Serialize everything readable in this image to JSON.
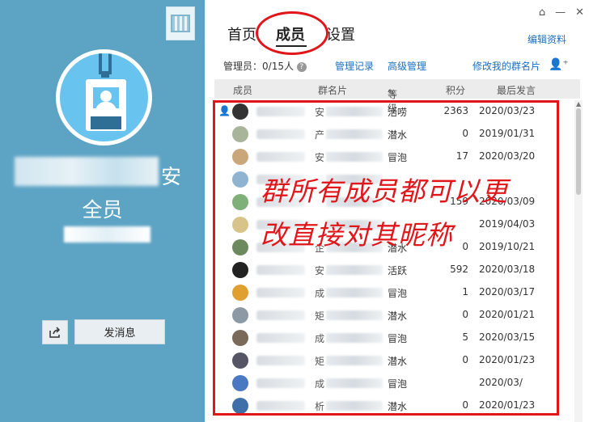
{
  "left": {
    "name_line1": "安",
    "name_line2": "全员",
    "send_message": "发消息"
  },
  "header": {
    "tabs": [
      "首页",
      "成员",
      "设置"
    ],
    "edit_profile": "编辑资料"
  },
  "toolbar": {
    "admin_label": "管理员：",
    "admin_count": "0/15人",
    "manage_log": "管理记录",
    "advanced": "高级管理",
    "edit_card": "修改我的群名片"
  },
  "table": {
    "headers": [
      "成员",
      "群名片",
      "等级",
      "积分",
      "最后发言"
    ],
    "rows": [
      {
        "card": "安",
        "level": "活唠",
        "points": "2363",
        "date": "2020/03/23"
      },
      {
        "card": "产",
        "level": "潜水",
        "points": "0",
        "date": "2019/01/31"
      },
      {
        "card": "安",
        "level": "冒泡",
        "points": "17",
        "date": "2020/03/20"
      },
      {
        "card": "",
        "level": "",
        "points": "",
        "date": ""
      },
      {
        "card": "",
        "level": "",
        "points": "159",
        "date": "2020/03/09"
      },
      {
        "card": "",
        "level": "",
        "points": "",
        "date": "2019/04/03"
      },
      {
        "card": "企",
        "level": "潜水",
        "points": "0",
        "date": "2019/10/21"
      },
      {
        "card": "安",
        "level": "活跃",
        "points": "592",
        "date": "2020/03/18"
      },
      {
        "card": "成",
        "level": "冒泡",
        "points": "1",
        "date": "2020/03/17"
      },
      {
        "card": "矩",
        "level": "潜水",
        "points": "0",
        "date": "2020/01/21"
      },
      {
        "card": "成",
        "level": "冒泡",
        "points": "5",
        "date": "2020/03/15"
      },
      {
        "card": "矩",
        "level": "潜水",
        "points": "0",
        "date": "2020/01/23"
      },
      {
        "card": "成",
        "level": "冒泡",
        "points": "",
        "date": "2020/03/"
      },
      {
        "card": "析",
        "level": "潜水",
        "points": "0",
        "date": "2020/01/23"
      }
    ]
  },
  "annotation": {
    "line1": "群所有成员都可以更",
    "line2": "改直接对其昵称"
  },
  "colors": {
    "left_bg": "#5da3c4",
    "link": "#1a6fc2",
    "annotation_red": "#e0161b"
  }
}
